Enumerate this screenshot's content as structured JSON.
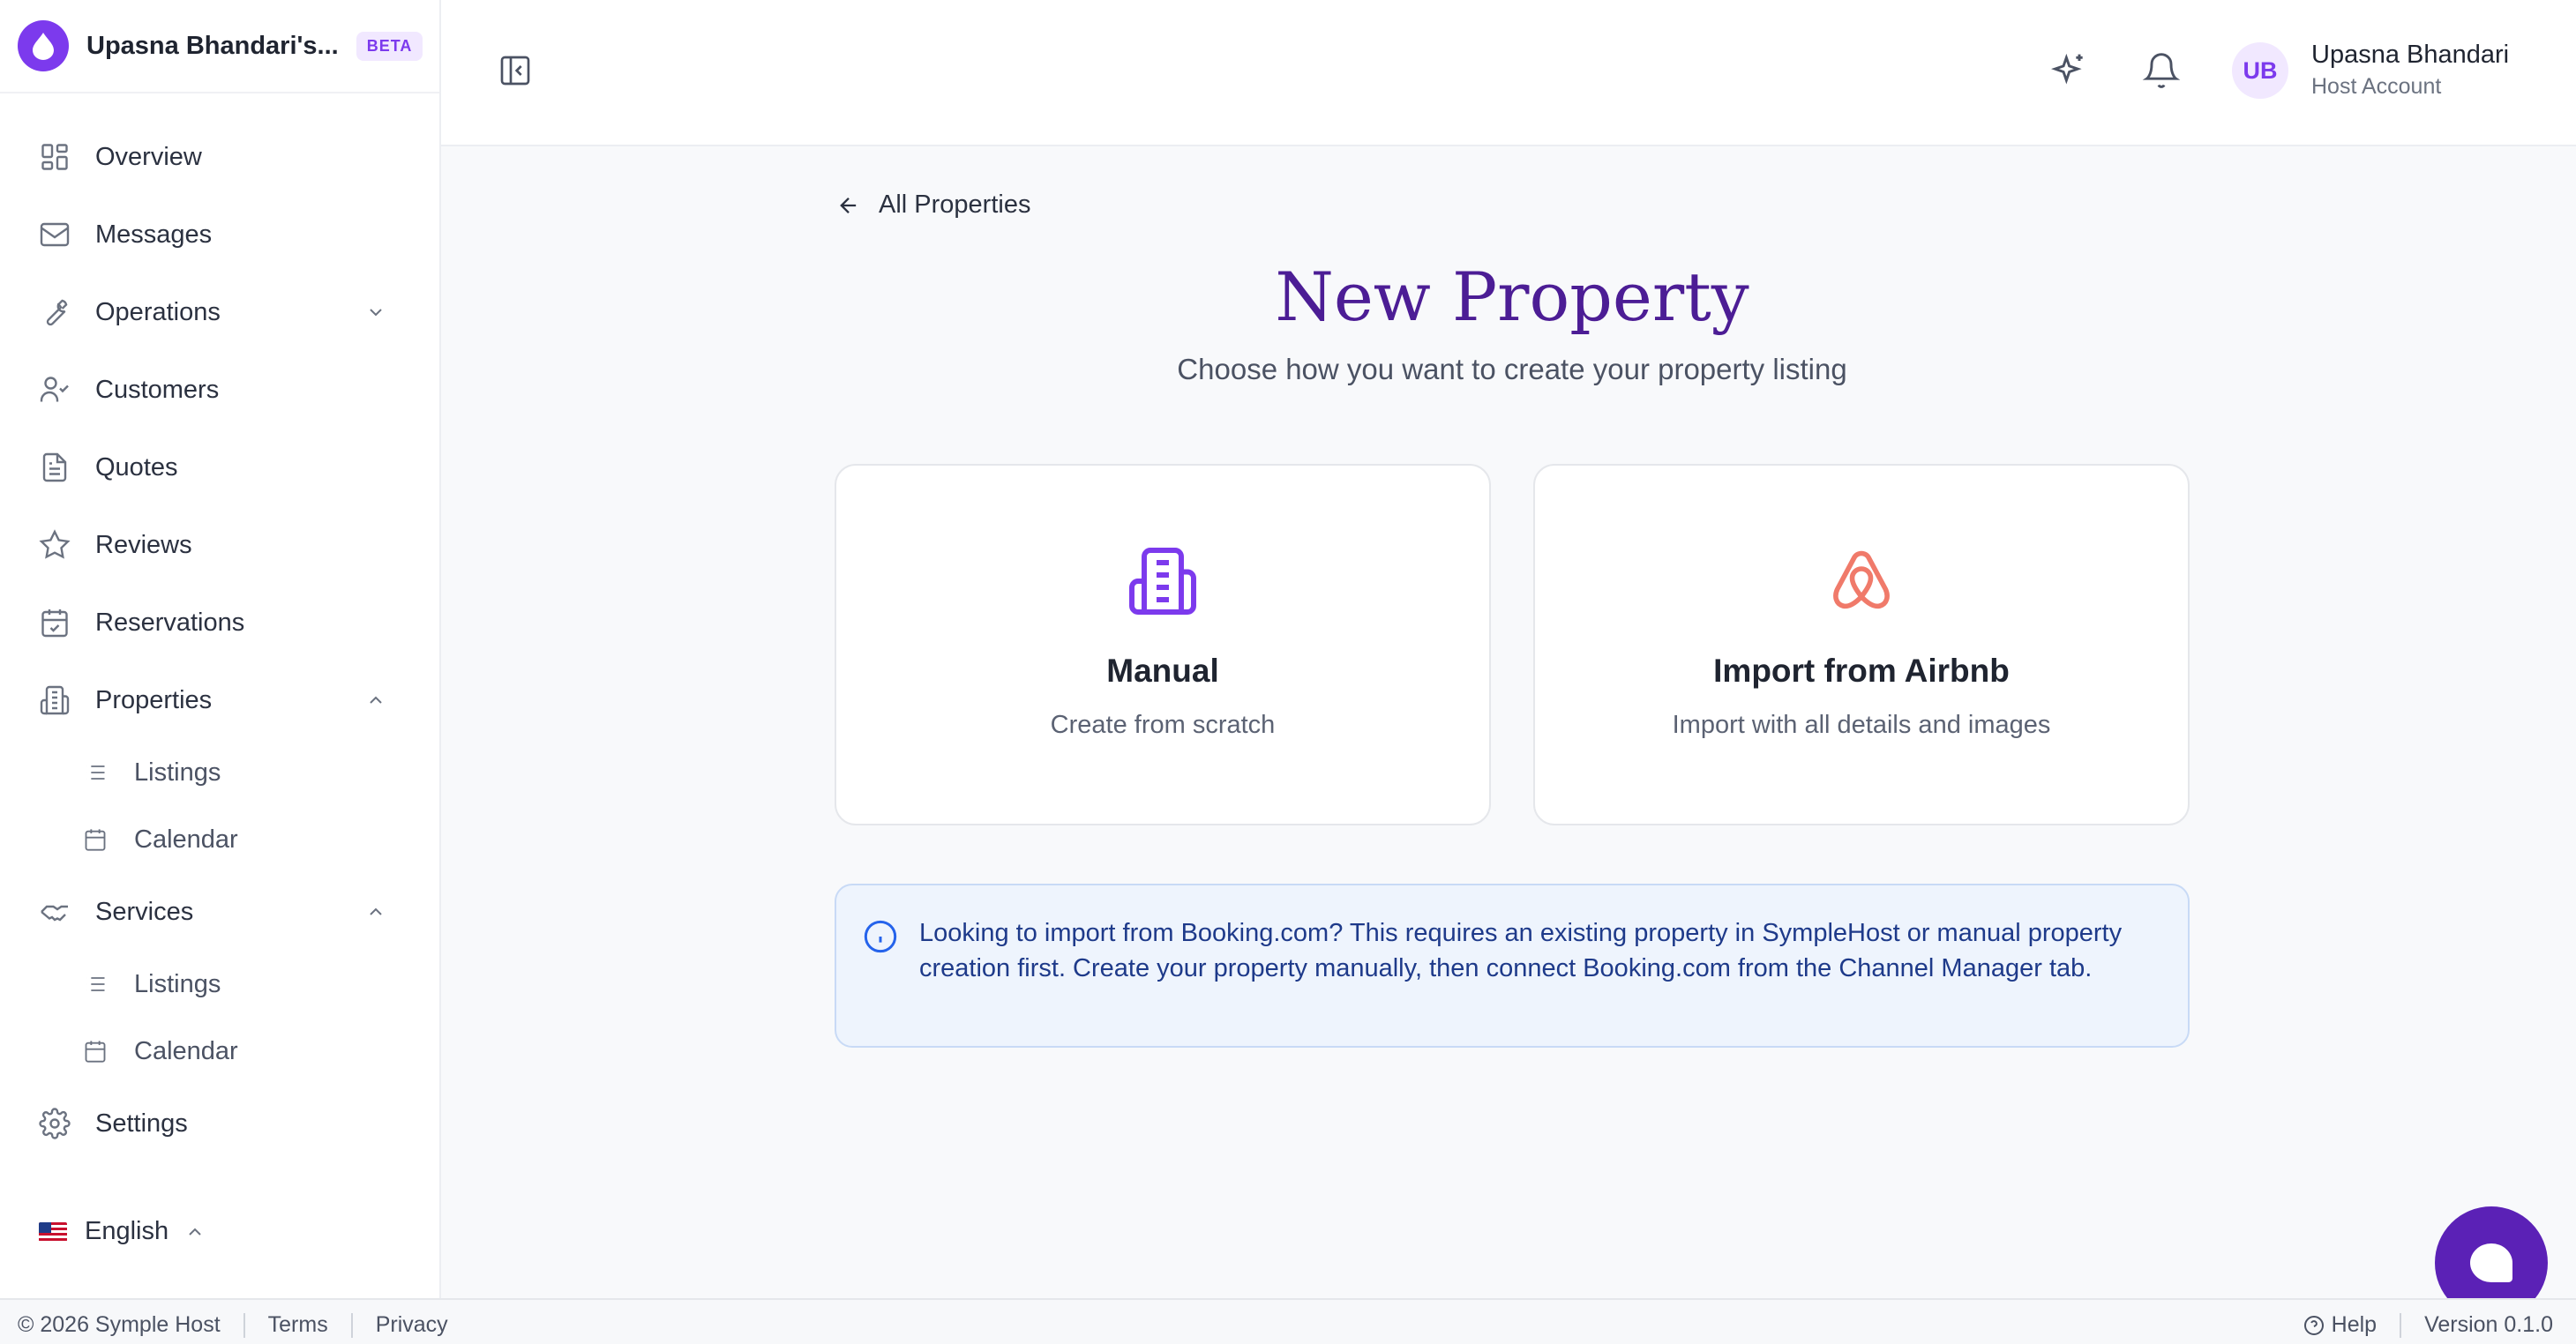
{
  "sidebar": {
    "brand_name": "Upasna Bhandari's...",
    "beta_label": "BETA",
    "items": [
      {
        "label": "Overview",
        "icon": "grid-icon"
      },
      {
        "label": "Messages",
        "icon": "mail-icon"
      },
      {
        "label": "Operations",
        "icon": "wrench-icon",
        "expanded": false
      },
      {
        "label": "Customers",
        "icon": "user-check-icon"
      },
      {
        "label": "Quotes",
        "icon": "document-icon"
      },
      {
        "label": "Reviews",
        "icon": "star-icon"
      },
      {
        "label": "Reservations",
        "icon": "calendar-check-icon"
      },
      {
        "label": "Properties",
        "icon": "building-icon",
        "expanded": true
      },
      {
        "label": "Services",
        "icon": "handshake-icon",
        "expanded": true
      },
      {
        "label": "Settings",
        "icon": "gear-icon"
      }
    ],
    "properties_sub": [
      {
        "label": "Listings",
        "icon": "list-icon"
      },
      {
        "label": "Calendar",
        "icon": "calendar-icon"
      }
    ],
    "services_sub": [
      {
        "label": "Listings",
        "icon": "list-icon"
      },
      {
        "label": "Calendar",
        "icon": "calendar-icon"
      }
    ],
    "language": "English"
  },
  "header": {
    "avatar_initials": "UB",
    "user_name": "Upasna Bhandari",
    "user_role": "Host Account"
  },
  "main": {
    "back_label": "All Properties",
    "title": "New Property",
    "subtitle": "Choose how you want to create your property listing",
    "options": [
      {
        "title": "Manual",
        "desc": "Create from scratch",
        "icon": "building-icon",
        "color": "#7c3aed"
      },
      {
        "title": "Import from Airbnb",
        "desc": "Import with all details and images",
        "icon": "airbnb-icon",
        "color": "#f07a6a"
      }
    ],
    "info_text": "Looking to import from Booking.com? This requires an existing property in SympleHost or manual property creation first. Create your property manually, then connect Booking.com from the Channel Manager tab."
  },
  "footer": {
    "copyright": "© 2026 Symple Host",
    "terms": "Terms",
    "privacy": "Privacy",
    "help": "Help",
    "version": "Version 0.1.0"
  },
  "colors": {
    "accent": "#7c3aed",
    "title": "#4c1d95",
    "airbnb": "#f07a6a",
    "info_bg": "#eef4fd",
    "info_text": "#1e3a8a"
  }
}
